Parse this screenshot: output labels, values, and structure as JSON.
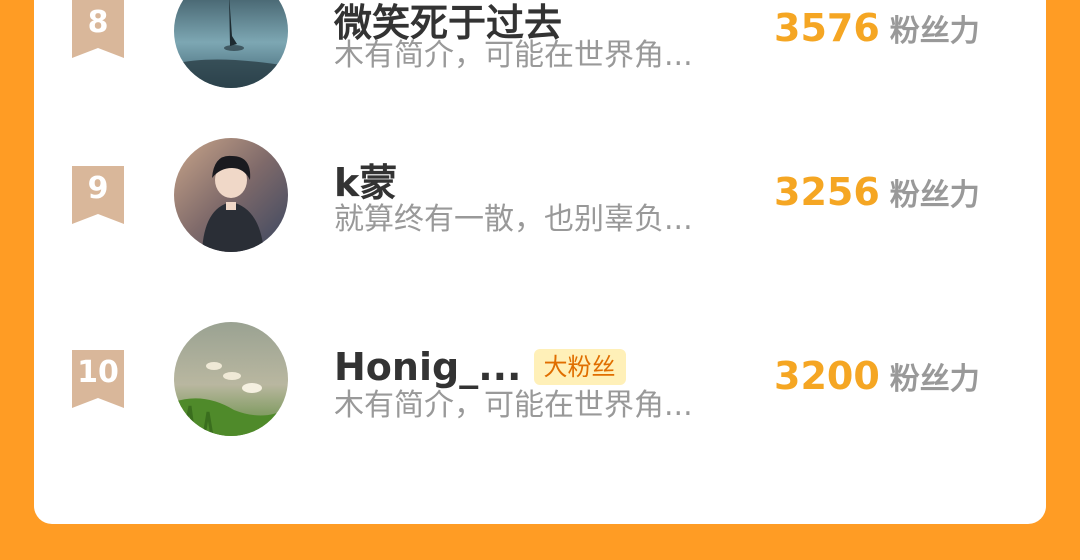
{
  "colors": {
    "page_background": "#ff9c24",
    "card_background": "#ffffff",
    "rank_badge": "#d9b79a",
    "score": "#f5a623",
    "fan_tag_background": "#fff0b8",
    "fan_tag_text": "#e06e00"
  },
  "ranking": {
    "score_label": "粉丝力",
    "rows": [
      {
        "rank": "8",
        "name": "微笑死于过去",
        "bio": "木有简介，可能在世界角...",
        "score": "3576",
        "tag": "",
        "avatar_icon": "avatar-reflection-photo"
      },
      {
        "rank": "9",
        "name": "k蒙",
        "bio": "就算终有一散，也别辜负...",
        "score": "3256",
        "tag": "",
        "avatar_icon": "avatar-anime-boy"
      },
      {
        "rank": "10",
        "name": "Honig_...",
        "bio": "木有简介，可能在世界角...",
        "score": "3200",
        "tag": "大粉丝",
        "avatar_icon": "avatar-geese-pond"
      }
    ]
  }
}
